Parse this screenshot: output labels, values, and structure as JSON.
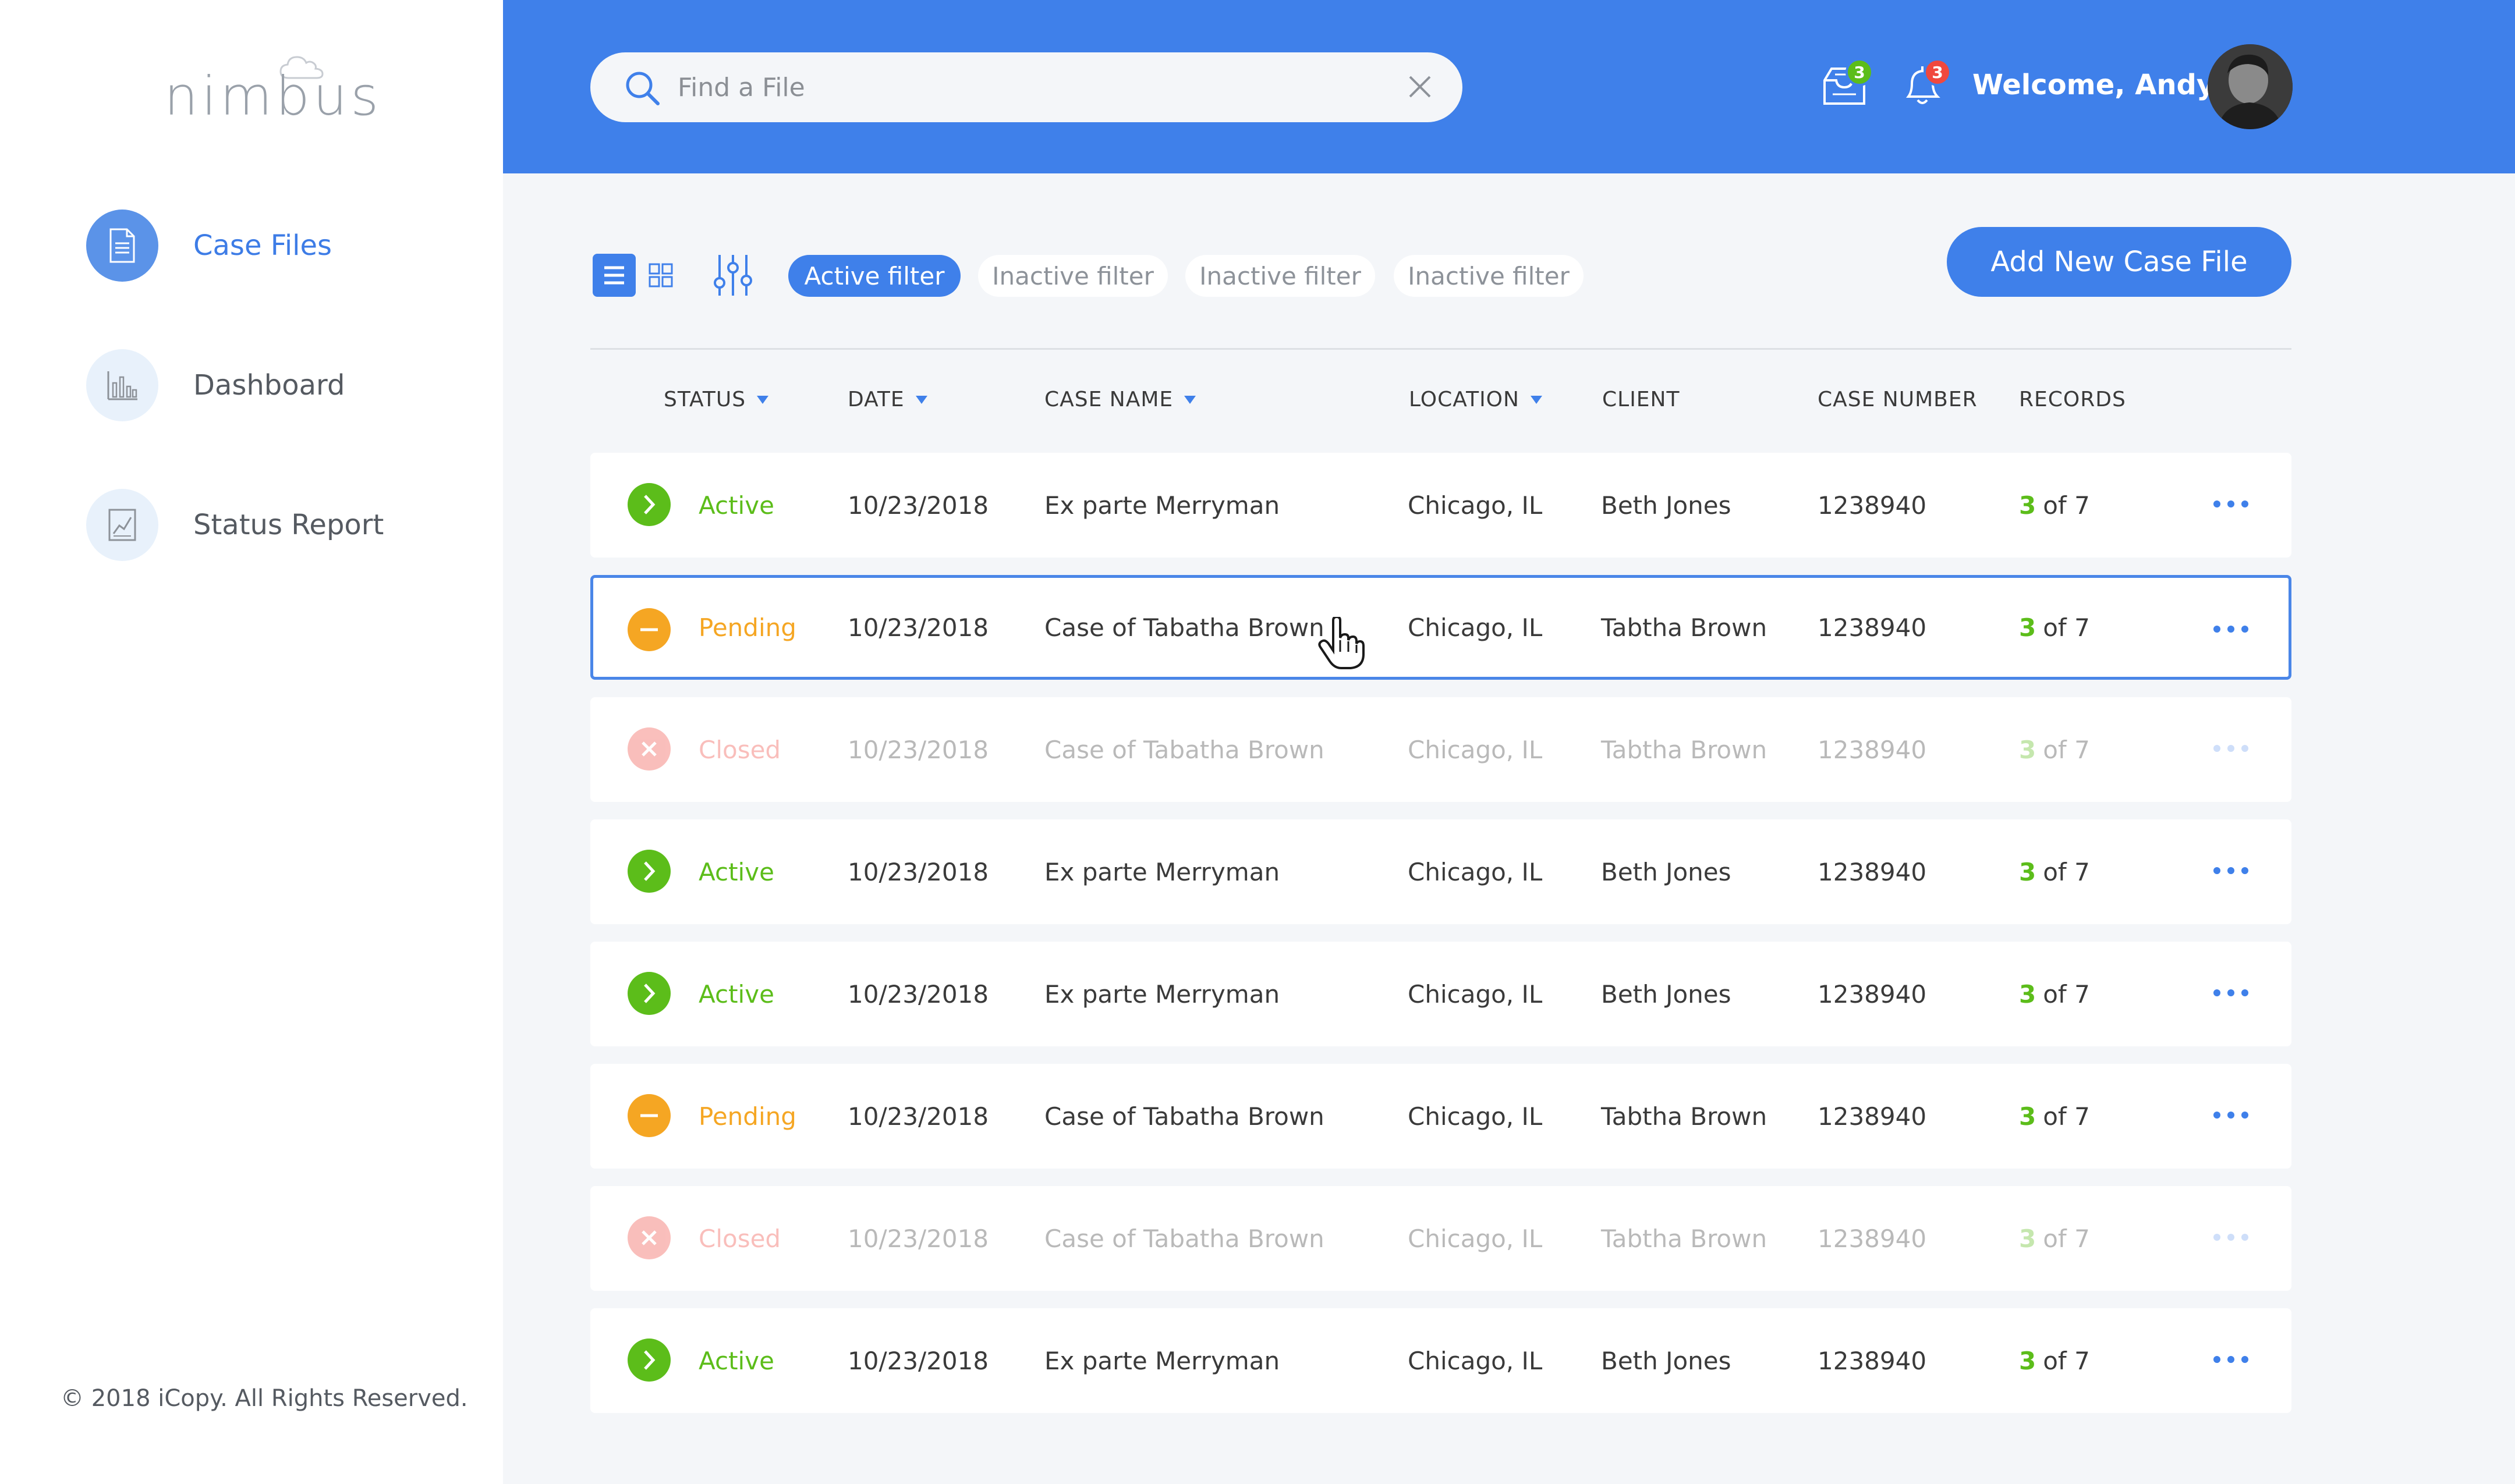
{
  "brand": {
    "logo_text": "nimbus"
  },
  "sidebar": {
    "items": [
      {
        "label": "Case Files",
        "icon": "document-icon",
        "active": true
      },
      {
        "label": "Dashboard",
        "icon": "bar-chart-icon",
        "active": false
      },
      {
        "label": "Status Report",
        "icon": "line-chart-icon",
        "active": false
      }
    ],
    "copyright": "© 2018 iCopy. All Rights Reserved."
  },
  "header": {
    "search_placeholder": "Find a File",
    "messages_badge": "3",
    "notifications_badge": "3",
    "welcome": "Welcome, Andy",
    "badge_colors": {
      "messages": "#5cbd1a",
      "notifications": "#f0483e"
    }
  },
  "toolbar": {
    "filters": [
      "Active filter",
      "Inactive filter",
      "Inactive filter",
      "Inactive filter"
    ],
    "add_button": "Add New Case File"
  },
  "table": {
    "columns": [
      "STATUS",
      "DATE",
      "CASE NAME",
      "LOCATION",
      "CLIENT",
      "CASE NUMBER",
      "RECORDS"
    ],
    "rows": [
      {
        "status": "Active",
        "date": "10/23/2018",
        "case_name": "Ex parte Merryman",
        "location": "Chicago, IL",
        "client": "Beth Jones",
        "case_number": "1238940",
        "records_done": "3",
        "records_total": "of 7"
      },
      {
        "status": "Pending",
        "date": "10/23/2018",
        "case_name": "Case of Tabatha Brown",
        "location": "Chicago, IL",
        "client": "Tabtha Brown",
        "case_number": "1238940",
        "records_done": "3",
        "records_total": "of 7"
      },
      {
        "status": "Closed",
        "date": "10/23/2018",
        "case_name": "Case of Tabatha Brown",
        "location": "Chicago, IL",
        "client": "Tabtha Brown",
        "case_number": "1238940",
        "records_done": "3",
        "records_total": "of 7"
      },
      {
        "status": "Active",
        "date": "10/23/2018",
        "case_name": "Ex parte Merryman",
        "location": "Chicago, IL",
        "client": "Beth Jones",
        "case_number": "1238940",
        "records_done": "3",
        "records_total": "of 7"
      },
      {
        "status": "Active",
        "date": "10/23/2018",
        "case_name": "Ex parte Merryman",
        "location": "Chicago, IL",
        "client": "Beth Jones",
        "case_number": "1238940",
        "records_done": "3",
        "records_total": "of 7"
      },
      {
        "status": "Pending",
        "date": "10/23/2018",
        "case_name": "Case of Tabatha Brown",
        "location": "Chicago, IL",
        "client": "Tabtha Brown",
        "case_number": "1238940",
        "records_done": "3",
        "records_total": "of 7"
      },
      {
        "status": "Closed",
        "date": "10/23/2018",
        "case_name": "Case of Tabatha Brown",
        "location": "Chicago, IL",
        "client": "Tabtha Brown",
        "case_number": "1238940",
        "records_done": "3",
        "records_total": "of 7"
      },
      {
        "status": "Active",
        "date": "10/23/2018",
        "case_name": "Ex parte Merryman",
        "location": "Chicago, IL",
        "client": "Beth Jones",
        "case_number": "1238940",
        "records_done": "3",
        "records_total": "of 7"
      }
    ]
  },
  "colors": {
    "accent": "#3f80ea",
    "active": "#5cbd1a",
    "pending": "#f5a623",
    "closed": "#f0483e"
  }
}
